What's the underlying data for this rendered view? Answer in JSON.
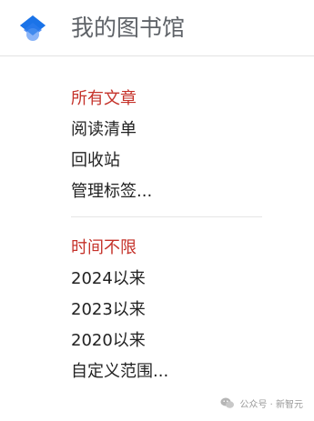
{
  "header": {
    "title": "我的图书馆",
    "logo_icon": "google-books-logo-icon",
    "logo_colors": [
      "#1a73e8",
      "#4285f4",
      "#8ab4f8"
    ]
  },
  "sections": [
    {
      "title": "所有文章",
      "items": [
        "阅读清单",
        "回收站",
        "管理标签..."
      ]
    },
    {
      "title": "时间不限",
      "items": [
        "2024以来",
        "2023以来",
        "2020以来",
        "自定义范围..."
      ]
    }
  ],
  "watermark": {
    "text": "公众号 · 新智元",
    "icon": "wechat-icon"
  },
  "colors": {
    "section_title": "#c5322a",
    "title_gray": "#5f6368",
    "divider": "#e3e3e3"
  }
}
